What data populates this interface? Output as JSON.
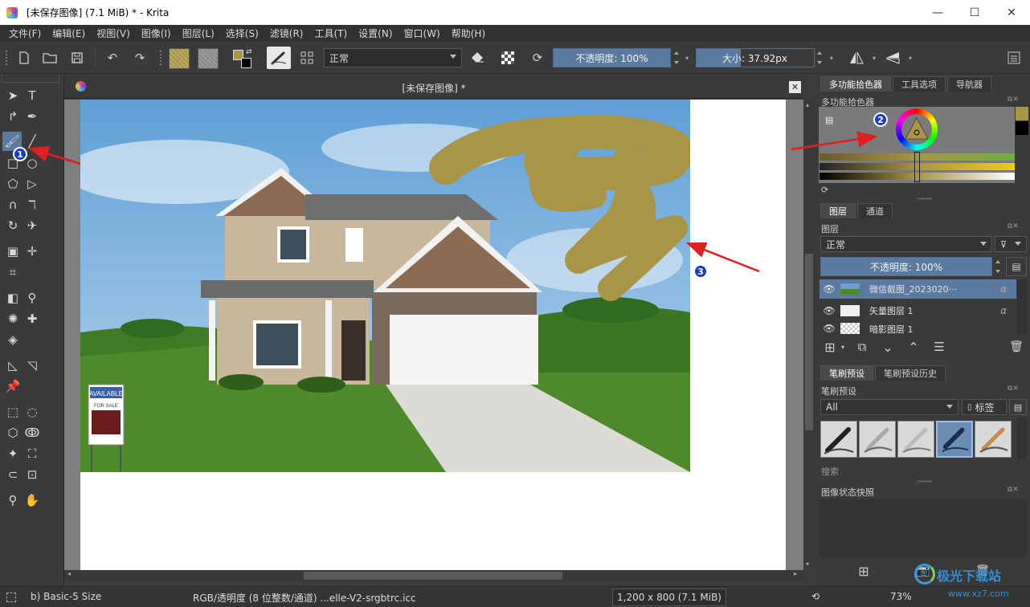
{
  "window": {
    "title": "[未保存图像]  (7.1 MiB)  * - Krita",
    "minimize": "—",
    "maximize": "☐",
    "close": "✕"
  },
  "menu": [
    "文件(F)",
    "编辑(E)",
    "视图(V)",
    "图像(I)",
    "图层(L)",
    "选择(S)",
    "滤镜(R)",
    "工具(T)",
    "设置(N)",
    "窗口(W)",
    "帮助(H)"
  ],
  "toolbar": {
    "blend_mode": "正常",
    "opacity_label": "不透明度: 100%",
    "size_label": "大小: 37.92px",
    "fg_color": "#a89545",
    "bg_color": "#000000"
  },
  "canvas": {
    "tab_title": "[未保存图像]  *",
    "close_label": "✕",
    "paint_color": "#a89545",
    "sign_text": "AVAILABLE",
    "sign_sub": "FOR SALE"
  },
  "dock": {
    "top_tabs": [
      "多功能拾色器",
      "工具选项",
      "导航器"
    ],
    "color_selector_title": "多功能拾色器",
    "layers_tabs": [
      "图层",
      "通道"
    ],
    "layers_title": "图层",
    "layer_blend": "正常",
    "layer_opacity": "不透明度:  100%",
    "layers": [
      {
        "name": "微信截图_2023020···",
        "selected": true
      },
      {
        "name": "矢量图层 1",
        "selected": false
      },
      {
        "name": "暗影图层 1",
        "selected": false
      }
    ],
    "brush_tabs": [
      "笔刷预设",
      "笔刷预设历史"
    ],
    "brush_title": "笔刷预设",
    "brush_filter": "All",
    "brush_tag": "标签",
    "brush_search": "搜索",
    "snapshot_title": "图像状态快照"
  },
  "status": {
    "brush": "b) Basic-5 Size",
    "color_space": "RGB/透明度 (8 位整数/通道) ...elle-V2-srgbtrc.icc",
    "dimensions": "1,200 x 800 (7.1 MiB)",
    "zoom": "73%"
  },
  "annotations": {
    "marker1": "1",
    "marker2": "2",
    "marker3": "3",
    "arrow_color": "#e0201e"
  },
  "watermark": {
    "site": "极光下载站",
    "url": "www.xz7.com"
  }
}
